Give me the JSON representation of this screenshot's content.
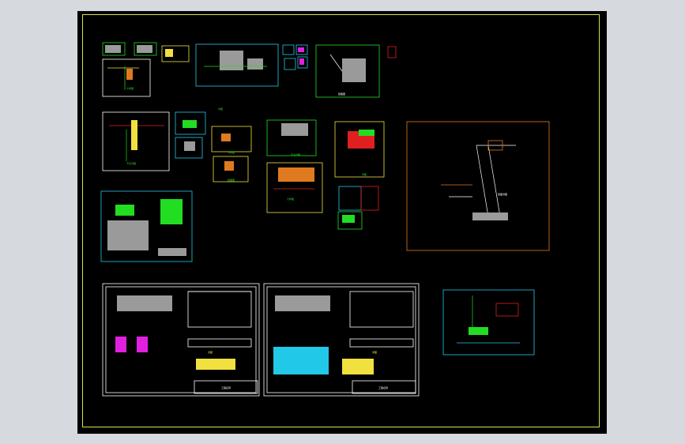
{
  "viewport": {
    "background": "#d6d9de",
    "canvas_background": "#000000",
    "border_color": "#d7e24a"
  },
  "colors": {
    "white": "#ffffff",
    "green": "#22dd22",
    "yellow": "#f0e040",
    "cyan": "#22c8e8",
    "red": "#e02020",
    "orange": "#e07a20",
    "magenta": "#e020e0",
    "gray": "#9a9a9a",
    "teal": "#3aa0a0"
  },
  "labels": {
    "b1": "大样图",
    "b2": "节点详图",
    "b3": "详图",
    "b4": "剖面图",
    "b5": "大样图",
    "b6": "节点详图",
    "b7": "详图",
    "b8": "节点图",
    "b9": "剖面图",
    "main": "剖面详图",
    "s1": "详图",
    "s2": "详图",
    "tb1": "工程名称",
    "tb2": "工程名称"
  }
}
